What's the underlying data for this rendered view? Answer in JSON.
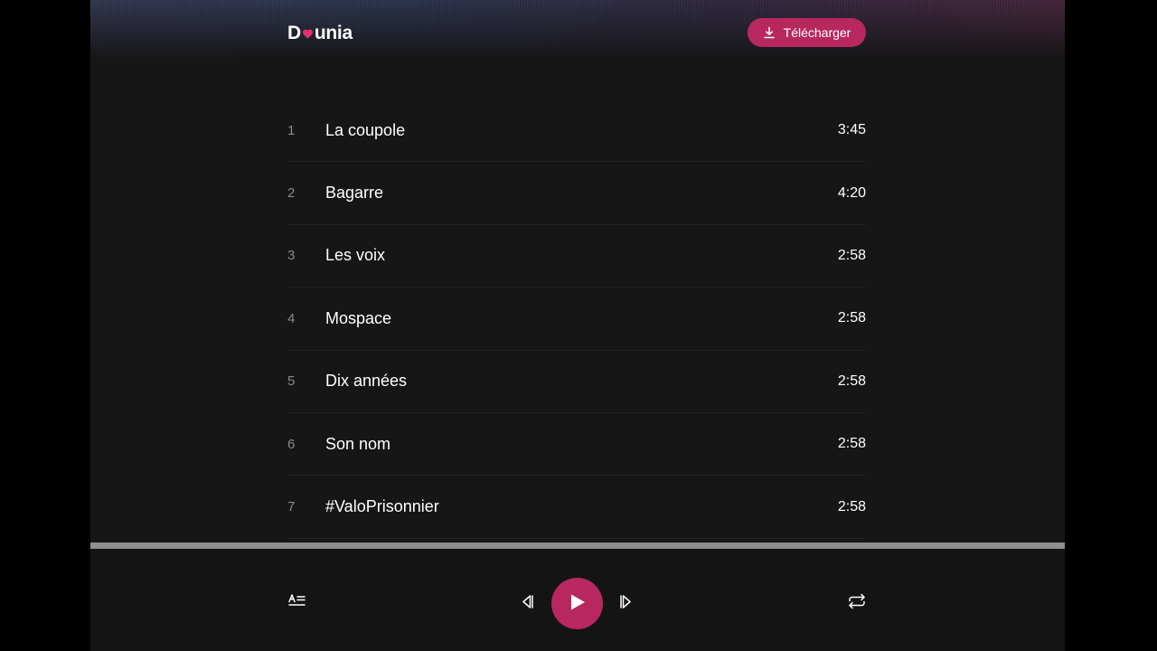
{
  "header": {
    "logo": {
      "prefix": "D",
      "suffix": "unia",
      "heart_color": "#e0306f"
    },
    "download_label": "Télécharger"
  },
  "tracks": [
    {
      "number": "1",
      "title": "La coupole",
      "duration": "3:45"
    },
    {
      "number": "2",
      "title": "Bagarre",
      "duration": "4:20"
    },
    {
      "number": "3",
      "title": "Les voix",
      "duration": "2:58"
    },
    {
      "number": "4",
      "title": "Mospace",
      "duration": "2:58"
    },
    {
      "number": "5",
      "title": "Dix années",
      "duration": "2:58"
    },
    {
      "number": "6",
      "title": "Son nom",
      "duration": "2:58"
    },
    {
      "number": "7",
      "title": "#ValoPrisonnier",
      "duration": "2:58"
    }
  ],
  "player": {
    "icons": {
      "lyrics": "lyrics-icon",
      "previous": "skip-previous-icon",
      "play": "play-icon",
      "next": "skip-next-icon",
      "repeat": "repeat-icon"
    },
    "accent_color": "#b8285f"
  }
}
